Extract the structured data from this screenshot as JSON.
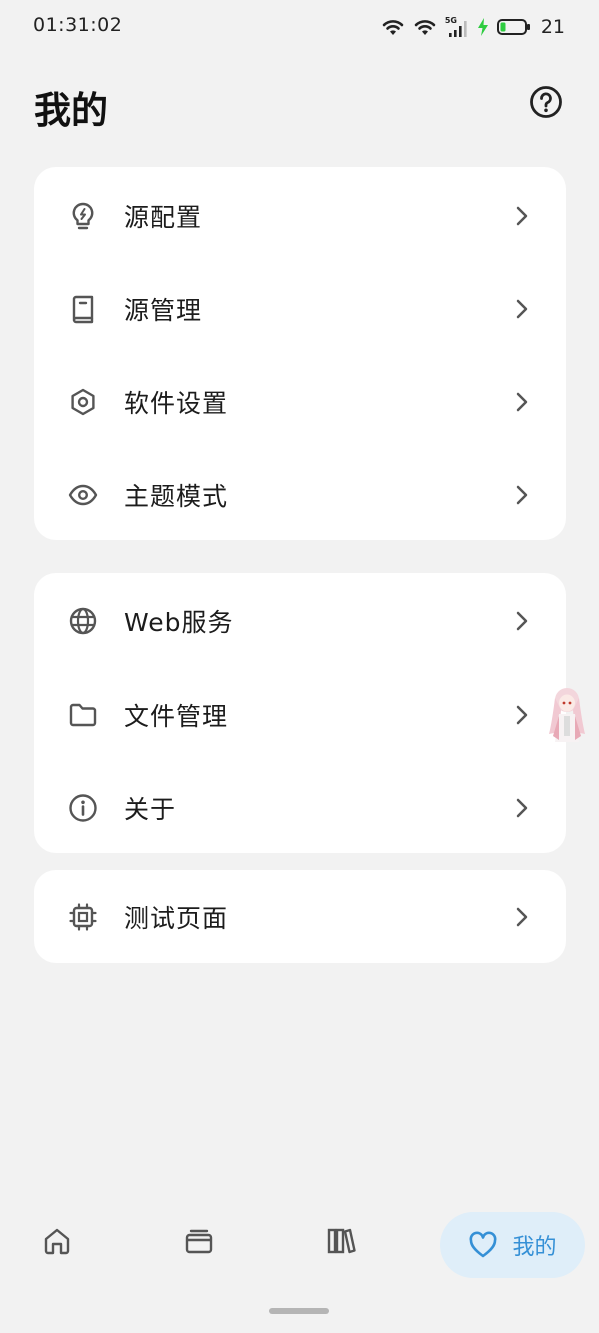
{
  "status_bar": {
    "time": "01:31:02",
    "network_label": "5G",
    "battery_level": "21",
    "accent_charge": "#2ecc40"
  },
  "header": {
    "title": "我的",
    "help_icon": "help-circle-icon"
  },
  "cards": [
    {
      "items": [
        {
          "label": "源配置",
          "icon": "lightbulb-icon"
        },
        {
          "label": "源管理",
          "icon": "book-icon"
        },
        {
          "label": "软件设置",
          "icon": "hexagon-settings-icon"
        },
        {
          "label": "主题模式",
          "icon": "eye-icon"
        }
      ]
    },
    {
      "items": [
        {
          "label": "Web服务",
          "icon": "globe-icon"
        },
        {
          "label": "文件管理",
          "icon": "folder-icon"
        },
        {
          "label": "关于",
          "icon": "info-icon"
        }
      ]
    },
    {
      "items": [
        {
          "label": "测试页面",
          "icon": "chip-icon"
        }
      ]
    }
  ],
  "bottom_nav": {
    "items": [
      {
        "icon": "home-icon"
      },
      {
        "icon": "inbox-icon"
      },
      {
        "icon": "library-icon"
      },
      {
        "icon": "heart-icon",
        "label": "我的",
        "active": true
      }
    ],
    "accent_color": "#3590d6",
    "active_bg": "#dfeef9"
  }
}
